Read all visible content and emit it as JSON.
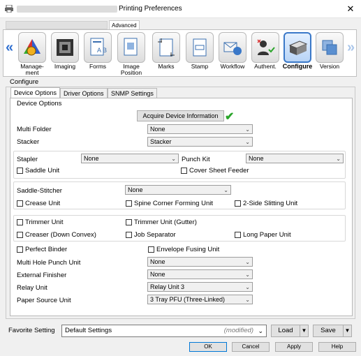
{
  "window": {
    "title": "Printing Preferences",
    "close_glyph": "✕",
    "active_top_tab": "Advanced"
  },
  "ribbon": {
    "left_arrow": "«",
    "right_arrow": "»",
    "tools": [
      {
        "label": "Manage-\nment",
        "icon": "management-icon"
      },
      {
        "label": "Imaging",
        "icon": "imaging-icon"
      },
      {
        "label": "Forms",
        "icon": "forms-icon"
      },
      {
        "label": "Image\nPosition",
        "icon": "image-position-icon"
      },
      {
        "label": "Marks",
        "icon": "marks-icon"
      },
      {
        "label": "Stamp",
        "icon": "stamp-icon"
      },
      {
        "label": "Workflow",
        "icon": "workflow-icon"
      },
      {
        "label": "Authent.",
        "icon": "authentication-icon"
      },
      {
        "label": "Configure",
        "icon": "configure-icon",
        "selected": true
      },
      {
        "label": "Version",
        "icon": "version-icon"
      }
    ]
  },
  "configure": {
    "group_label": "Configure",
    "tabs": [
      "Device Options",
      "Driver Options",
      "SNMP Settings"
    ],
    "active_tab": "Device Options",
    "device_options": {
      "group_label": "Device Options",
      "acquire_button": "Acquire Device Information",
      "multi_folder": {
        "label": "Multi Folder",
        "value": "None"
      },
      "stacker": {
        "label": "Stacker",
        "value": "Stacker"
      },
      "stapler": {
        "label": "Stapler",
        "value": "None"
      },
      "punch_kit": {
        "label": "Punch Kit",
        "value": "None"
      },
      "saddle_unit": "Saddle Unit",
      "cover_sheet_feeder": "Cover Sheet Feeder",
      "saddle_stitcher": {
        "label": "Saddle-Stitcher",
        "value": "None"
      },
      "crease_unit": "Crease Unit",
      "spine_corner": "Spine Corner Forming Unit",
      "two_side_slitting": "2-Side Slitting Unit",
      "trimmer_unit": "Trimmer Unit",
      "trimmer_gutter": "Trimmer Unit (Gutter)",
      "creaser": "Creaser (Down Convex)",
      "job_separator": "Job Separator",
      "long_paper": "Long Paper Unit",
      "perfect_binder": "Perfect Binder",
      "envelope_fusing": "Envelope Fusing Unit",
      "multi_hole_punch": {
        "label": "Multi Hole Punch Unit",
        "value": "None"
      },
      "external_finisher": {
        "label": "External Finisher",
        "value": "None"
      },
      "relay_unit": {
        "label": "Relay Unit",
        "value": "Relay Unit 3"
      },
      "paper_source": {
        "label": "Paper Source Unit",
        "value": "3 Tray PFU (Three-Linked)"
      }
    }
  },
  "favorite": {
    "label": "Favorite Setting",
    "value": "Default Settings",
    "modified": "(modified)",
    "load": "Load",
    "save": "Save"
  },
  "footer": {
    "ok": "OK",
    "cancel": "Cancel",
    "apply": "Apply",
    "help": "Help"
  },
  "colors": {
    "accent": "#3a78c8",
    "check": "#2aa52a"
  }
}
